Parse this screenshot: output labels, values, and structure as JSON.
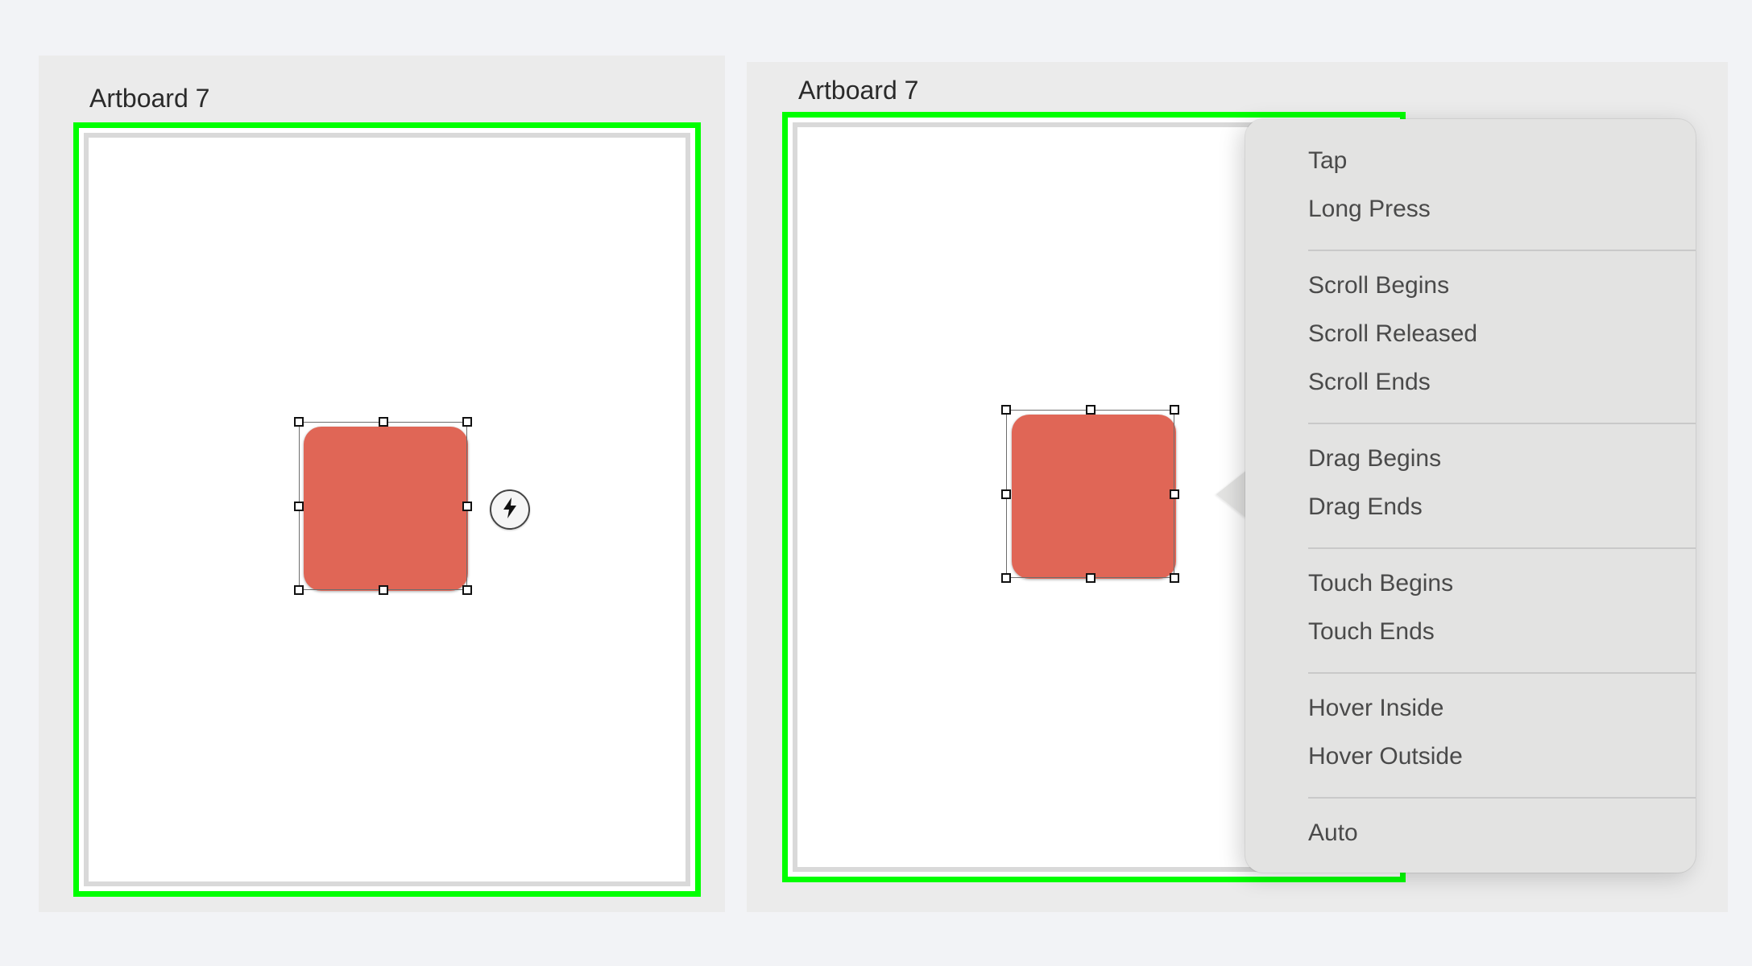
{
  "artboards": [
    {
      "title": "Artboard 7"
    },
    {
      "title": "Artboard 7"
    }
  ],
  "colors": {
    "artboard_border": "#00ff00",
    "shape_fill": "#e06656"
  },
  "trigger_icon": "lightning-bolt-icon",
  "trigger_menu": {
    "groups": [
      [
        "Tap",
        "Long Press"
      ],
      [
        "Scroll Begins",
        "Scroll Released",
        "Scroll Ends"
      ],
      [
        "Drag Begins",
        "Drag Ends"
      ],
      [
        "Touch Begins",
        "Touch Ends"
      ],
      [
        "Hover Inside",
        "Hover Outside"
      ],
      [
        "Auto"
      ]
    ]
  }
}
